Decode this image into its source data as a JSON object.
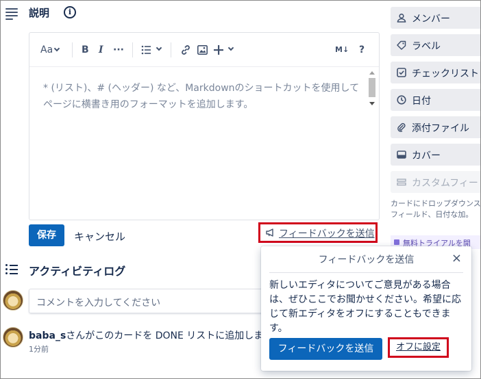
{
  "description": {
    "title": "説明",
    "info_icon": "i",
    "editor": {
      "toolbar": {
        "text_style_label": "Aa",
        "bold_label": "B",
        "italic_label": "I",
        "more_label": "···",
        "markdown_label": "M↓",
        "help_label": "?"
      },
      "placeholder_line1": "* (リスト)、# (ヘッダー) など、Markdownのショートカットを使用して",
      "placeholder_line2": "ページに横書き用のフォーマットを追加します。"
    },
    "save_label": "保存",
    "cancel_label": "キャンセル",
    "feedback_link_label": "フィードバックを送信"
  },
  "activity": {
    "title": "アクティビティログ",
    "comment_placeholder": "コメントを入力してください",
    "entries": [
      {
        "user": "baba_s",
        "text": "さんがこのカードを DONE リストに追加しまし",
        "time": "1分前"
      }
    ]
  },
  "sidebar": {
    "items": [
      {
        "label": "メンバー",
        "icon": "person-icon"
      },
      {
        "label": "ラベル",
        "icon": "tag-icon"
      },
      {
        "label": "チェックリスト",
        "icon": "checkbox-icon"
      },
      {
        "label": "日付",
        "icon": "clock-icon"
      },
      {
        "label": "添付ファイル",
        "icon": "paperclip-icon"
      },
      {
        "label": "カバー",
        "icon": "cover-icon"
      },
      {
        "label": "カスタムフィー",
        "icon": "custom-field-icon"
      }
    ],
    "note": "カードにドロップダウンストフィールド、日付な加。",
    "trial_label": "無料トライアルを開"
  },
  "popover": {
    "title": "フィードバックを送信",
    "close_label": "×",
    "body": "新しいエディタについてご意見がある場合は、ぜひここでお聞かせください。希望に応じて新エディタをオフにすることもできます。",
    "send_label": "フィードバックを送信",
    "off_label": "オフに設定"
  },
  "colors": {
    "primary": "#0c66ba",
    "highlight": "#d0021b",
    "sidebar_button": "#ebecf0"
  }
}
